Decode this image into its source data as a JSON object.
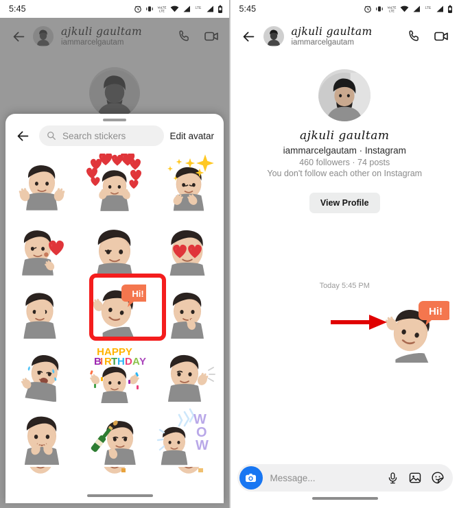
{
  "status_bar": {
    "time": "5:45",
    "icons": [
      "alarm-icon",
      "vibrate-icon",
      "volte-icon",
      "wifi-icon",
      "signal-icon",
      "lte-icon",
      "signal-2-icon",
      "battery-icon"
    ]
  },
  "chat_header": {
    "back_icon": "back-arrow-icon",
    "avatar": "contact-avatar",
    "name": "ajkuli gaultam",
    "handle": "iammarcelgautam",
    "call_icon": "phone-call-icon",
    "video_icon": "video-call-icon"
  },
  "sticker_sheet": {
    "grabber": "drag-handle",
    "back_icon": "back-arrow-icon",
    "search": {
      "icon": "search-icon",
      "placeholder": "Search stickers",
      "value": ""
    },
    "edit_avatar_label": "Edit avatar",
    "selection_color": "#f41d1d",
    "selected_index": 7,
    "stickers": [
      {
        "name": "avatar-thumbs-up-sticker",
        "label": "Thumbs up"
      },
      {
        "name": "avatar-hearts-sticker",
        "label": "Surrounded by hearts"
      },
      {
        "name": "avatar-namaste-sparkles-sticker",
        "label": "Namaste with sparkles"
      },
      {
        "name": "avatar-blow-kiss-sticker",
        "label": "Blowing a kiss"
      },
      {
        "name": "avatar-wink-sticker",
        "label": "Winking"
      },
      {
        "name": "avatar-heart-eyes-sticker",
        "label": "Heart eyes"
      },
      {
        "name": "avatar-facepalm-sticker",
        "label": "Facepalm"
      },
      {
        "name": "avatar-hi-wave-sticker",
        "label": "Hi!"
      },
      {
        "name": "avatar-thinking-sticker",
        "label": "Thinking"
      },
      {
        "name": "avatar-laugh-cry-sticker",
        "label": "Laughing with tears"
      },
      {
        "name": "avatar-happy-birthday-sticker",
        "label": "HAPPY BIRTHDAY"
      },
      {
        "name": "avatar-shrug-sticker",
        "label": "Shrug"
      },
      {
        "name": "avatar-pleading-hands-sticker",
        "label": "Pleading hands"
      },
      {
        "name": "avatar-champagne-sticker",
        "label": "Champagne celebration"
      },
      {
        "name": "avatar-wow-sticker",
        "label": "WOW"
      }
    ],
    "sticker_bubble_text": "Hi!",
    "birthday_text": "HAPPY BIRTHDAY",
    "wow_text": "WOW"
  },
  "profile": {
    "avatar": "profile-photo",
    "name": "ajkuli gaultam",
    "handle_line": "iammarcelgautam · Instagram",
    "stats_line": "460 followers · 74 posts",
    "relationship_line": "You don't follow each other on Instagram",
    "view_profile_label": "View Profile"
  },
  "thread": {
    "day_stamp": "Today 5:45 PM",
    "sent_sticker": {
      "name": "avatar-hi-wave-sticker",
      "bubble_text": "Hi!"
    },
    "annotation": {
      "name": "annotation-arrow",
      "color": "#e00000"
    }
  },
  "composer": {
    "camera_icon": "camera-icon",
    "camera_color": "#1876f2",
    "placeholder": "Message...",
    "mic_icon": "microphone-icon",
    "gallery_icon": "gallery-icon",
    "sticker_icon": "sticker-icon"
  },
  "nav_bar": {
    "pill": "home-gesture-pill"
  },
  "theme": {
    "background": "#ffffff",
    "scrim": "rgba(90,90,90,0.62)",
    "bubble_orange": "#f4764e",
    "heart_red": "#e0353a",
    "accent_blue": "#1876f2"
  }
}
